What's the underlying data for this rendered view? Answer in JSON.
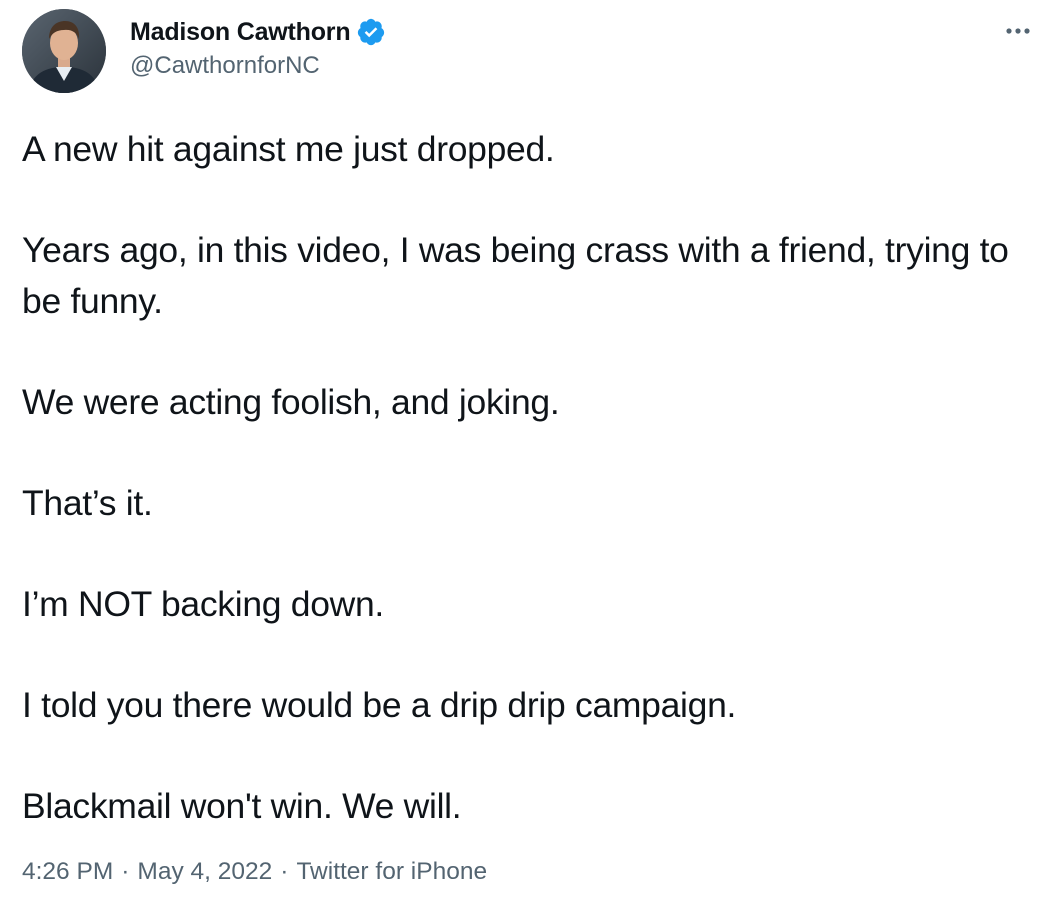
{
  "author": {
    "display_name": "Madison Cawthorn",
    "handle": "@CawthornforNC",
    "verified_icon": "verified-badge-icon",
    "verified_color": "#1d9bf0"
  },
  "menu": {
    "icon": "more-options-icon"
  },
  "tweet": {
    "paragraphs": [
      "A new hit against me just dropped.",
      "Years ago, in this video, I was being crass with a friend, trying to be funny.",
      "We were acting foolish, and joking.",
      "That’s it.",
      "I’m NOT backing down.",
      "I told you there would be a drip drip campaign.",
      "Blackmail won't win. We will."
    ]
  },
  "meta": {
    "time": "4:26 PM",
    "date": "May 4, 2022",
    "source": "Twitter for iPhone",
    "separator": "·"
  },
  "colors": {
    "text_primary": "#0f1419",
    "text_secondary": "#536471",
    "accent": "#1d9bf0"
  }
}
